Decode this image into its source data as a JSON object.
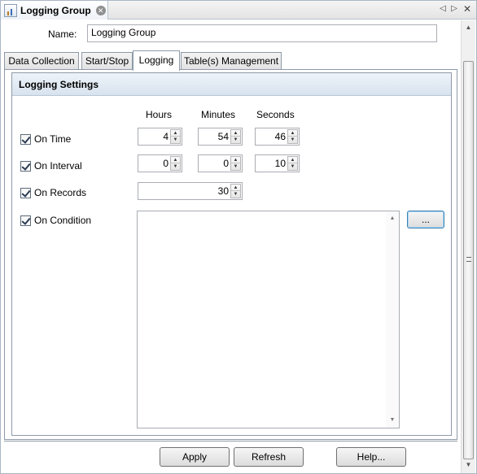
{
  "window": {
    "title": "Logging Group"
  },
  "name_field": {
    "label": "Name:",
    "value": "Logging Group"
  },
  "tabs": [
    {
      "label": "Data Collection",
      "active": false
    },
    {
      "label": "Start/Stop",
      "active": false
    },
    {
      "label": "Logging",
      "active": true
    },
    {
      "label": "Table(s) Management",
      "active": false
    }
  ],
  "section": {
    "title": "Logging Settings"
  },
  "columns": {
    "hours": "Hours",
    "minutes": "Minutes",
    "seconds": "Seconds"
  },
  "on_time": {
    "label": "On Time",
    "checked": true,
    "hours": "4",
    "minutes": "54",
    "seconds": "46"
  },
  "on_interval": {
    "label": "On Interval",
    "checked": true,
    "hours": "0",
    "minutes": "0",
    "seconds": "10"
  },
  "on_records": {
    "label": "On Records",
    "checked": true,
    "value": "30"
  },
  "on_condition": {
    "label": "On Condition",
    "checked": true,
    "value": "",
    "browse_label": "..."
  },
  "buttons": {
    "apply": "Apply",
    "refresh": "Refresh",
    "help": "Help..."
  },
  "colors": {
    "section_header": "#d8e3ef",
    "border": "#8e9aa8",
    "focus": "#3c7fb1"
  }
}
